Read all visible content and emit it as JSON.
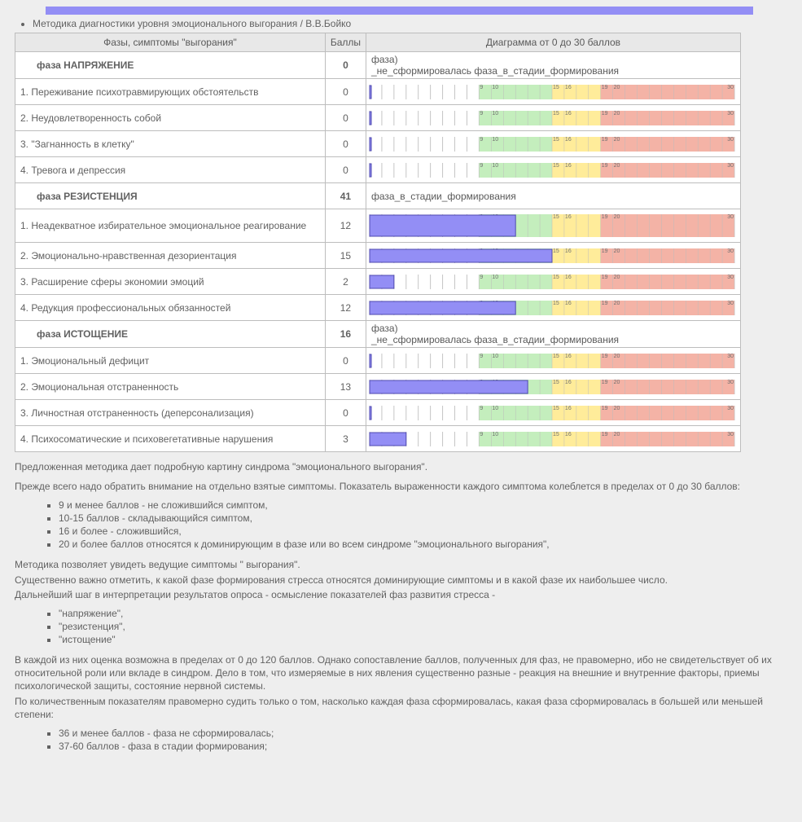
{
  "title": "Методика диагностики уровня эмоционального выгорания / В.В.Бойко",
  "headers": {
    "col1": "Фазы, симптомы \"выгорания\"",
    "col2": "Баллы",
    "col3": "Диаграмма от 0 до 30 баллов"
  },
  "phase_label_not_formed_a": "фаза)",
  "phase_label_not_formed_b": "_не_сформировалась   фаза_в_стадии_формирования",
  "phase_label_forming": "фаза_в_стадии_формирования",
  "phases": [
    {
      "idx": 0,
      "name": "фаза НАПРЯЖЕНИЕ",
      "score": 0,
      "status": "not_formed"
    },
    {
      "idx": 1,
      "name": "фаза РЕЗИСТЕНЦИЯ",
      "score": 41,
      "status": "forming"
    },
    {
      "idx": 2,
      "name": "фаза ИСТОЩЕНИЕ",
      "score": 16,
      "status": "not_formed"
    }
  ],
  "rows": [
    {
      "phase": 0,
      "name": "1. Переживание психотравмирующих обстоятельств",
      "score": 0
    },
    {
      "phase": 0,
      "name": "2. Неудовлетворенность собой",
      "score": 0
    },
    {
      "phase": 0,
      "name": "3. \"Загнанность в клетку\"",
      "score": 0
    },
    {
      "phase": 0,
      "name": "4. Тревога и депрессия",
      "score": 0
    },
    {
      "phase": 1,
      "name": "1. Неадекватное избирательное эмоциональное реагирование",
      "score": 12
    },
    {
      "phase": 1,
      "name": "2. Эмоционально-нравственная дезориентация",
      "score": 15
    },
    {
      "phase": 1,
      "name": "3. Расширение сферы экономии эмоций",
      "score": 2
    },
    {
      "phase": 1,
      "name": "4. Редукция профессиональных обязанностей",
      "score": 12
    },
    {
      "phase": 2,
      "name": "1. Эмоциональный дефицит",
      "score": 0
    },
    {
      "phase": 2,
      "name": "2. Эмоциональная отстраненность",
      "score": 13
    },
    {
      "phase": 2,
      "name": "3. Личностная отстраненность (деперсонализация)",
      "score": 0
    },
    {
      "phase": 2,
      "name": "4. Психосоматические и психовегетативные нарушения",
      "score": 3
    }
  ],
  "chart_data": {
    "type": "bar",
    "title": "Диаграмма от 0 до 30 баллов",
    "xlabel": "Баллы",
    "ylabel": "",
    "xlim": [
      0,
      30
    ],
    "zones": [
      {
        "from": 0,
        "to": 9,
        "label": "не сложившийся симптом",
        "color": "#c9efc1"
      },
      {
        "from": 9,
        "to": 10,
        "label": "",
        "color": "#c9efc1"
      },
      {
        "from": 10,
        "to": 15,
        "label": "складывающийся симптом",
        "color": "#c9efc1"
      },
      {
        "from": 15,
        "to": 16,
        "label": "",
        "color": "#ffec9a"
      },
      {
        "from": 16,
        "to": 19,
        "label": "сложившийся",
        "color": "#ffec9a"
      },
      {
        "from": 19,
        "to": 20,
        "label": "",
        "color": "#f5b7ab"
      },
      {
        "from": 20,
        "to": 30,
        "label": "доминирующий",
        "color": "#f5b7ab"
      }
    ],
    "tickmarks": [
      9,
      10,
      15,
      16,
      19,
      20,
      30
    ],
    "series": [
      {
        "group": "НАПРЯЖЕНИЕ",
        "name": "Переживание психотравмирующих обстоятельств",
        "value": 0
      },
      {
        "group": "НАПРЯЖЕНИЕ",
        "name": "Неудовлетворенность собой",
        "value": 0
      },
      {
        "group": "НАПРЯЖЕНИЕ",
        "name": "Загнанность в клетку",
        "value": 0
      },
      {
        "group": "НАПРЯЖЕНИЕ",
        "name": "Тревога и депрессия",
        "value": 0
      },
      {
        "group": "РЕЗИСТЕНЦИЯ",
        "name": "Неадекватное избирательное эмоциональное реагирование",
        "value": 12
      },
      {
        "group": "РЕЗИСТЕНЦИЯ",
        "name": "Эмоционально-нравственная дезориентация",
        "value": 15
      },
      {
        "group": "РЕЗИСТЕНЦИЯ",
        "name": "Расширение сферы экономии эмоций",
        "value": 2
      },
      {
        "group": "РЕЗИСТЕНЦИЯ",
        "name": "Редукция профессиональных обязанностей",
        "value": 12
      },
      {
        "group": "ИСТОЩЕНИЕ",
        "name": "Эмоциональный дефицит",
        "value": 0
      },
      {
        "group": "ИСТОЩЕНИЕ",
        "name": "Эмоциональная отстраненность",
        "value": 13
      },
      {
        "group": "ИСТОЩЕНИЕ",
        "name": "Личностная отстраненность (деперсонализация)",
        "value": 0
      },
      {
        "group": "ИСТОЩЕНИЕ",
        "name": "Психосоматические и психовегетативные нарушения",
        "value": 3
      }
    ],
    "phase_totals": [
      {
        "name": "НАПРЯЖЕНИЕ",
        "value": 0
      },
      {
        "name": "РЕЗИСТЕНЦИЯ",
        "value": 41
      },
      {
        "name": "ИСТОЩЕНИЕ",
        "value": 16
      }
    ]
  },
  "desc": {
    "p1": "Предложенная методика дает подробную картину синдрома \"эмоционального выгорания\".",
    "p2": "Прежде всего надо обратить внимание на отдельно взятые симптомы. Показатель выраженности каждого симптома колеблется в пределах от 0 до 30 баллов:",
    "list1": [
      "9 и менее баллов - не сложившийся симптом,",
      "10-15 баллов - складывающийся симптом,",
      "16 и более - сложившийся,",
      "20 и более баллов относятся к доминирующим в фазе или во всем синдроме \"эмоционального выгорания\","
    ],
    "p3": "Методика позволяет увидеть ведущие симптомы \" выгорания\".",
    "p4": "Существенно важно отметить, к какой фазе формирования стресса относятся доминирующие симптомы и в какой фазе их наибольшее число.",
    "p5": "Дальнейший шаг в интерпретации результатов опроса - осмысление показателей фаз развития стресса -",
    "list2": [
      "\"напряжение\",",
      "\"резистенция\",",
      "\"истощение\""
    ],
    "p6": "В каждой из них оценка возможна в пределах от 0 до 120 баллов. Однако сопоставление баллов, полученных для фаз, не правомерно, ибо не свидетельствует об их относительной роли или вкладе в синдром. Дело в том, что измеряемые в них явления существенно разные - реакция на внешние и внутренние факторы, приемы психологической защиты, состояние нервной системы.",
    "p7": "По количественным показателям правомерно судить только о том, насколько каждая фаза сформировалась, какая фаза сформировалась в большей или меньшей степени:",
    "list3": [
      "36 и менее баллов - фаза не сформировалась;",
      "37-60 баллов - фаза в стадии формирования;"
    ]
  }
}
